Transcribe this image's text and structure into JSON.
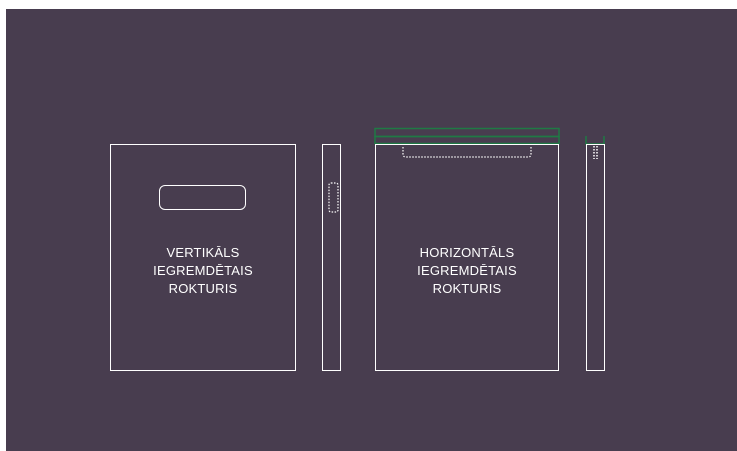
{
  "colors": {
    "background": "#483d4f",
    "outline": "#ffffff",
    "accent": "#1f7a45"
  },
  "vertical_bag": {
    "label_lines": [
      "VERTIKĀLS",
      "IEGREMDĒTAIS",
      "ROKTURIS"
    ]
  },
  "horizontal_bag": {
    "label_lines": [
      "HORIZONTĀLS",
      "IEGREMDĒTAIS",
      "ROKTURIS"
    ]
  }
}
